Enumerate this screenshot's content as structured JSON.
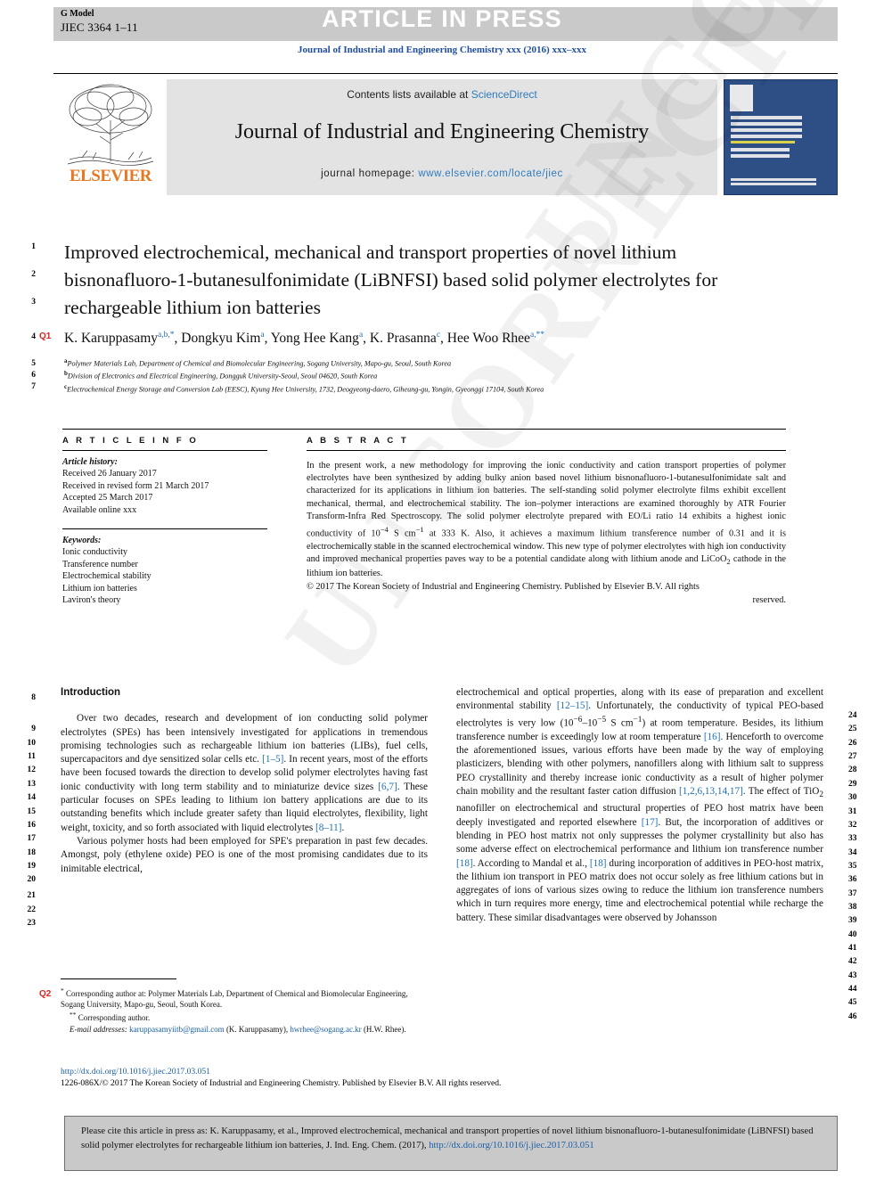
{
  "header": {
    "g_model_label": "G Model",
    "article_id": "JIEC 3364 1–11",
    "article_in_press": "ARTICLE IN PRESS",
    "journal_ref": "Journal of Industrial and Engineering Chemistry xxx (2016) xxx–xxx"
  },
  "masthead": {
    "contents_prefix": "Contents lists available at ",
    "sciencedirect": "ScienceDirect",
    "journal_title": "Journal of Industrial and Engineering Chemistry",
    "homepage_prefix": "journal homepage: ",
    "homepage_url": "www.elsevier.com/locate/jiec",
    "elsevier_wordmark": "ELSEVIER"
  },
  "article": {
    "title": "Improved electrochemical, mechanical and transport properties of novel lithium bisnonafluoro-1-butanesulfonimidate (LiBNFSI) based solid polymer electrolytes for rechargeable lithium ion batteries",
    "authors_html": "K. Karuppasamy<sup>a,b,*</sup>, Dongkyu Kim<sup>a</sup>, Yong Hee Kang<sup>a</sup>, K. Prasanna<sup>c</sup>, Hee Woo Rhee<sup>a,**</sup>",
    "affiliations": [
      {
        "marker": "a",
        "text": "Polymer Materials Lab, Department of Chemical and Biomolecular Engineering, Sogang University, Mapo-gu, Seoul, South Korea"
      },
      {
        "marker": "b",
        "text": "Division of Electronics and Electrical Engineering, Dongguk University-Seoul, Seoul 04620, South Korea"
      },
      {
        "marker": "c",
        "text": "Electrochemical Energy Storage and Conversion Lab (EESC), Kyung Hee University, 1732, Deogyeong-daero, Giheung-gu, Yongin, Gyeonggi 17104, South Korea"
      }
    ]
  },
  "article_info": {
    "heading": "A R T I C L E   I N F O",
    "history_label": "Article history:",
    "history": [
      "Received 26 January 2017",
      "Received in revised form 21 March 2017",
      "Accepted 25 March 2017",
      "Available online xxx"
    ],
    "keywords_label": "Keywords:",
    "keywords": [
      "Ionic conductivity",
      "Transference number",
      "Electrochemical stability",
      "Lithium ion batteries",
      "Laviron's theory"
    ]
  },
  "abstract": {
    "heading": "A B S T R A C T",
    "body": "In the present work, a new methodology for improving the ionic conductivity and cation transport properties of polymer electrolytes have been synthesized by adding bulky anion based novel lithium bisnonafluoro-1-butanesulfonimidate salt and characterized for its applications in lithium ion batteries. The self-standing solid polymer electrolyte films exhibit excellent mechanical, thermal, and electrochemical stability. The ion–polymer interactions are examined thoroughly by ATR Fourier Transform-Infra Red Spectroscopy. The solid polymer electrolyte prepared with EO/Li ratio 14 exhibits a highest ionic conductivity of 10−4 S cm−1 at 333 K. Also, it achieves a maximum lithium transference number of 0.31 and it is electrochemically stable in the scanned electrochemical window. This new type of polymer electrolytes with high ion conductivity and improved mechanical properties paves way to be a potential candidate along with lithium anode and LiCoO2 cathode in the lithium ion batteries.",
    "copyright": "© 2017 The Korean Society of Industrial and Engineering Chemistry. Published by Elsevier B.V. All rights",
    "copyright_tail": "reserved."
  },
  "body": {
    "intro_heading": "Introduction",
    "left_paragraphs": [
      "Over two decades, research and development of ion conducting solid polymer electrolytes (SPEs) has been intensively investigated for applications in tremendous promising technologies such as rechargeable lithium ion batteries (LIBs), fuel cells, supercapacitors and dye sensitized solar cells etc. [1–5]. In recent years, most of the efforts have been focused towards the direction to develop solid polymer electrolytes having fast ionic conductivity with long term stability and to miniaturize device sizes [6,7]. These particular focuses on SPEs leading to lithium ion battery applications are due to its outstanding benefits which include greater safety than liquid electrolytes, flexibility, light weight, toxicity, and so forth associated with liquid electrolytes [8–11].",
      "Various polymer hosts had been employed for SPE's preparation in past few decades. Amongst, poly (ethylene oxide) PEO is one of the most promising candidates due to its inimitable electrical,"
    ],
    "right_paragraphs": [
      "electrochemical and optical properties, along with its ease of preparation and excellent environmental stability [12–15]. Unfortunately, the conductivity of typical PEO-based electrolytes is very low (10−6–10−5 S cm−1) at room temperature. Besides, its lithium transference number is exceedingly low at room temperature [16]. Henceforth to overcome the aforementioned issues, various efforts have been made by the way of employing plasticizers, blending with other polymers, nanofillers along with lithium salt to suppress PEO crystallinity and thereby increase ionic conductivity as a result of higher polymer chain mobility and the resultant faster cation diffusion [1,2,6,13,14,17]. The effect of TiO2 nanofiller on electrochemical and structural properties of PEO host matrix have been deeply investigated and reported elsewhere [17]. But, the incorporation of additives or blending in PEO host matrix not only suppresses the polymer crystallinity but also has some adverse effect on electrochemical performance and lithium ion transference number [18]. According to Mandal et al., [18] during incorporation of additives in PEO-host matrix, the lithium ion transport in PEO matrix does not occur solely as free lithium cations but in aggregates of ions of various sizes owing to reduce the lithium ion transference numbers which in turn requires more energy, time and electrochemical potential while recharge the battery. These similar disadvantages were observed by Johansson"
    ]
  },
  "footnote": {
    "star_marker": "*",
    "star_text": "Corresponding author at: Polymer Materials Lab, Department of Chemical and Biomolecular Engineering, Sogang University, Mapo-gu, Seoul, South Korea.",
    "dstar_marker": "**",
    "dstar_text": "Corresponding author.",
    "email_label": "E-mail addresses:",
    "email_1": "karuppasamyiitb@gmail.com",
    "email_1_owner": "(K. Karuppasamy),",
    "email_2": "hwrhee@sogang.ac.kr",
    "email_2_owner": "(H.W. Rhee)."
  },
  "doi_block": {
    "doi_url": "http://dx.doi.org/10.1016/j.jiec.2017.03.051",
    "issn_copyright": "1226-086X/© 2017 The Korean Society of Industrial and Engineering Chemistry. Published by Elsevier B.V. All rights reserved."
  },
  "citation_box": {
    "text_before_link": "Please cite this article in press as: K. Karuppasamy, et al., Improved electrochemical, mechanical and transport properties of novel lithium bisnonafluoro-1-butanesulfonimidate (LiBNFSI) based solid polymer electrolytes for rechargeable lithium ion batteries, J. Ind. Eng. Chem. (2017), ",
    "link": "http://dx.doi.org/10.1016/j.jiec.2017.03.051"
  },
  "queries": [
    {
      "id": "Q1",
      "line": "4"
    },
    {
      "id": "Q2",
      "line": ""
    }
  ],
  "line_numbers": {
    "left": [
      "1",
      "2",
      "3",
      "4",
      "5",
      "6",
      "7",
      "8",
      "9",
      "10",
      "11",
      "12",
      "13",
      "14",
      "15",
      "16",
      "17",
      "18",
      "19",
      "20",
      "21",
      "22",
      "23"
    ],
    "right": [
      "24",
      "25",
      "26",
      "27",
      "28",
      "29",
      "30",
      "31",
      "32",
      "33",
      "34",
      "35",
      "36",
      "37",
      "38",
      "39",
      "40",
      "41",
      "42",
      "43",
      "44",
      "45",
      "46"
    ]
  },
  "watermark": {
    "text": "UNCORRECTED PROOF"
  },
  "colors": {
    "link": "#1a5fa8",
    "journal_ref": "#1f4e9c",
    "elsevier_orange": "#e87722",
    "query_red": "#e02020",
    "band_grey": "#c9c9c9"
  }
}
